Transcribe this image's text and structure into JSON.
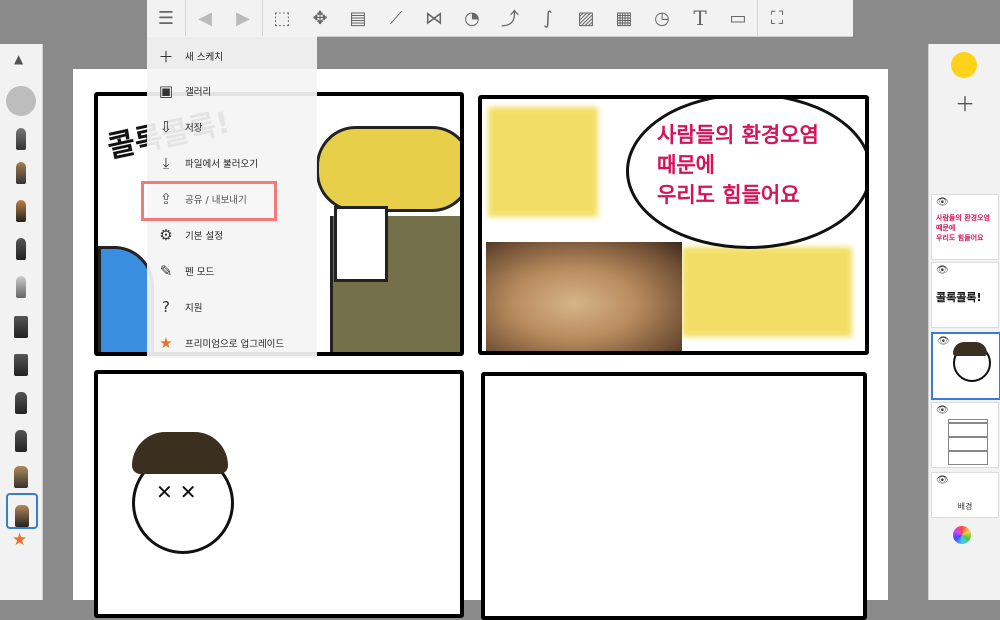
{
  "menu": {
    "items": [
      {
        "label": "새 스케치",
        "icon": "plus-icon"
      },
      {
        "label": "갤러리",
        "icon": "gallery-icon"
      },
      {
        "label": "저장",
        "icon": "save-icon"
      },
      {
        "label": "파일에서 불러오기",
        "icon": "import-icon"
      },
      {
        "label": "공유 / 내보내기",
        "icon": "share-export-icon"
      },
      {
        "label": "기본 설정",
        "icon": "gear-icon"
      },
      {
        "label": "펜 모드",
        "icon": "pen-icon"
      },
      {
        "label": "지원",
        "icon": "help-icon"
      },
      {
        "label": "프리미엄으로 업그레이드",
        "icon": "star-icon"
      }
    ],
    "highlighted_index": 4
  },
  "toolbar": {
    "icons": [
      "menu-icon",
      "undo-icon",
      "redo-icon",
      "select-icon",
      "transform-icon",
      "layer-fill-icon",
      "ruler-icon",
      "symmetry-icon",
      "shape-icon",
      "curve-icon",
      "stroke-icon",
      "image-icon",
      "perspective-icon",
      "time-lapse-icon",
      "text-icon",
      "video-icon",
      "fullscreen-icon"
    ]
  },
  "canvas": {
    "bubble_text": [
      "사람들의 환경오염",
      "때문에",
      "우리도 힘들어요"
    ],
    "panel1_text": "콜록콜록!"
  },
  "layers": [
    {
      "thumb_text": [
        "사람들의 환경오염",
        "때문에",
        "우리도 힘들어요"
      ]
    },
    {
      "thumb_text": [
        "콜록콜록!"
      ]
    },
    {
      "thumb_text": []
    },
    {
      "thumb_text": []
    },
    {
      "label": "배경"
    }
  ],
  "colors": {
    "current_color": "#FFD21A",
    "accent": "#D4145A",
    "highlight": "#F47A7A"
  }
}
